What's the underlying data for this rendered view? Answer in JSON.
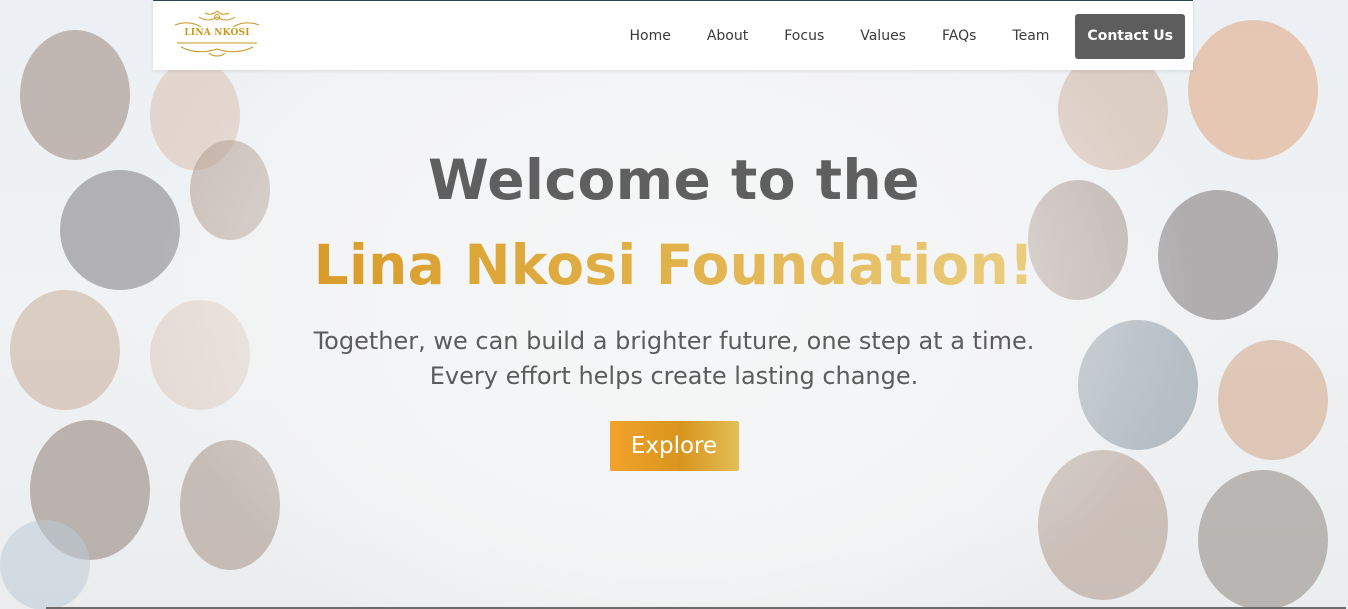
{
  "brand": {
    "logo_text": "LINA NKOSI",
    "logo_color": "#c9971d"
  },
  "nav": {
    "items": [
      {
        "label": "Home"
      },
      {
        "label": "About"
      },
      {
        "label": "Focus"
      },
      {
        "label": "Values"
      },
      {
        "label": "FAQs"
      },
      {
        "label": "Team"
      }
    ],
    "cta_label": "Contact Us"
  },
  "hero": {
    "headline_line1": "Welcome to the",
    "headline_line2": "Lina Nkosi Foundation!",
    "subtext_line1": "Together, we can build a brighter future, one step at a time.",
    "subtext_line2": "Every effort helps create lasting change.",
    "button_label": "Explore",
    "background": "photo of a diverse group of people looking down at the camera",
    "colors": {
      "headline_gray": "#5f5f5f",
      "gold_start": "#d6951e",
      "gold_end": "#eed690",
      "cta_gray": "#5d5d5d"
    }
  }
}
